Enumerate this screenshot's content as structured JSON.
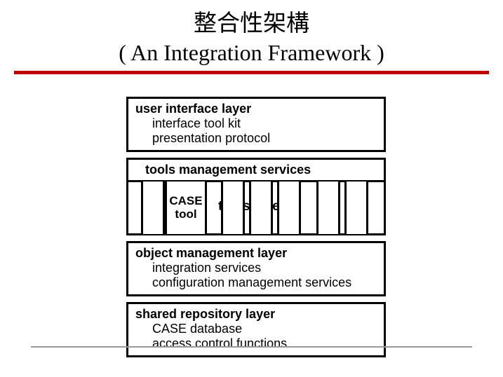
{
  "title": {
    "cn": "整合性架構",
    "en": "( An Integration Framework )"
  },
  "layers": {
    "ui": {
      "title": "user interface layer",
      "sub1": "interface tool kit",
      "sub2": "presentation protocol"
    },
    "tms": "tools management services",
    "case": {
      "line1": "CASE",
      "line2": "tool"
    },
    "tools_label": "tools layer",
    "oml": {
      "title": "object management layer",
      "sub1": "integration services",
      "sub2": "configuration management services"
    },
    "srl": {
      "title": "shared repository layer",
      "sub1": "CASE database",
      "sub2": "access control functions"
    }
  }
}
